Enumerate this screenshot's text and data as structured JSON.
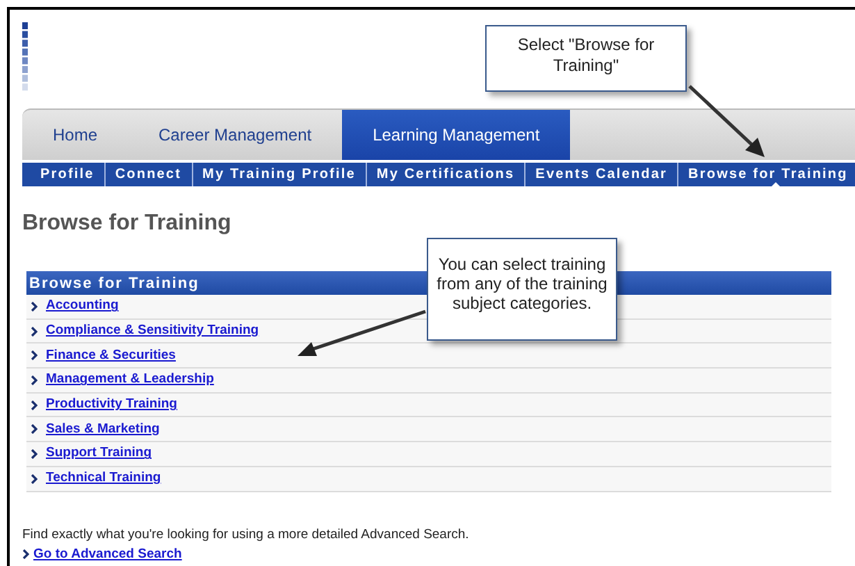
{
  "main_tabs": [
    {
      "label": "Home",
      "selected": false
    },
    {
      "label": "Career Management",
      "selected": false
    },
    {
      "label": "Learning Management",
      "selected": true
    }
  ],
  "sub_nav": [
    {
      "label": "Profile",
      "selected": false
    },
    {
      "label": "Connect",
      "selected": false
    },
    {
      "label": "My Training Profile",
      "selected": false
    },
    {
      "label": "My Certifications",
      "selected": false
    },
    {
      "label": "Events Calendar",
      "selected": false
    },
    {
      "label": "Browse for Training",
      "selected": true
    }
  ],
  "page_title": "Browse for Training",
  "panel": {
    "header": "Browse for Training",
    "categories": [
      "Accounting",
      "Compliance & Sensitivity Training",
      "Finance & Securities",
      "Management & Leadership",
      "Productivity Training",
      "Sales & Marketing",
      "Support Training",
      "Technical Training"
    ]
  },
  "footer": {
    "text": "Find exactly what you're looking for using a more detailed Advanced Search.",
    "link": "Go to Advanced Search"
  },
  "callouts": [
    "Select \"Browse for Training\"",
    "You can select training from any of the training subject categories."
  ]
}
